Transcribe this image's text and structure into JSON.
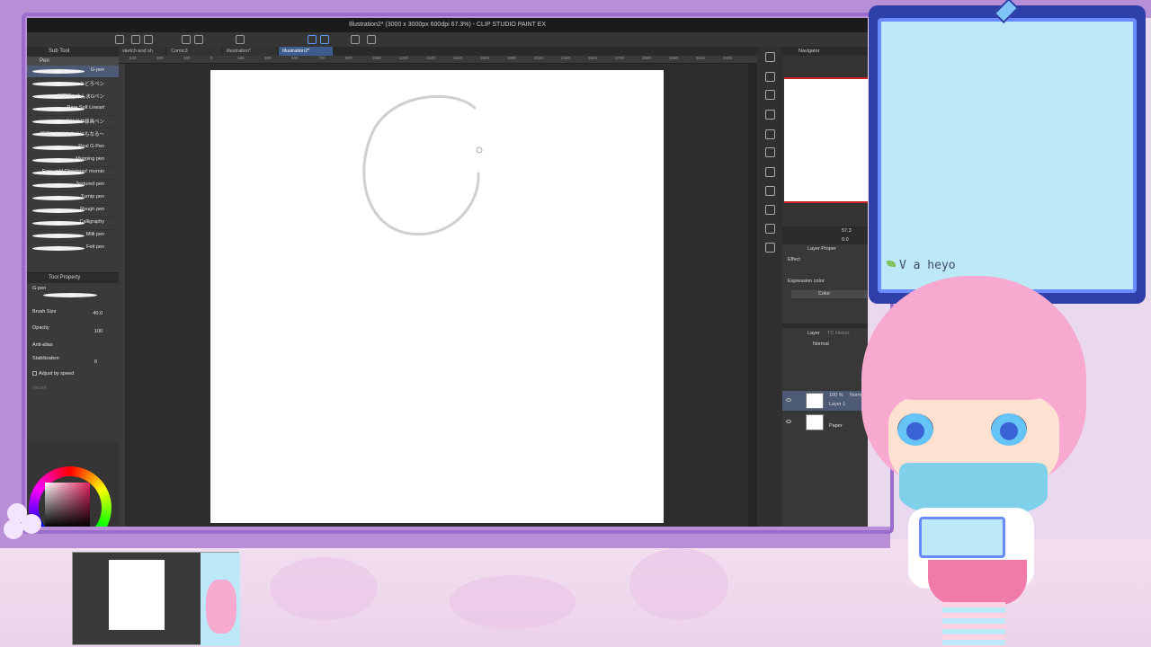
{
  "window": {
    "title": "Illustration2* (3000 x 3000px 600dpi 67.3%) - CLIP STUDIO PAINT EX"
  },
  "tabs": [
    {
      "label": "sketch and sh"
    },
    {
      "label": "Comic3"
    },
    {
      "label": "illustration*"
    },
    {
      "label": "Illustration2*"
    }
  ],
  "ruler_ticks": [
    "540",
    "360",
    "180",
    "0",
    "180",
    "360",
    "540",
    "720",
    "900",
    "1080",
    "1260",
    "1440",
    "1620",
    "1800",
    "1980",
    "2160",
    "2340",
    "2520",
    "2700",
    "2880",
    "3060",
    "3240",
    "3420"
  ],
  "subtool": {
    "header": "Sub Tool",
    "tab": "Pen",
    "brushes": [
      {
        "name": "G-pen"
      },
      {
        "name": "とどろペン"
      },
      {
        "name": "[ 初期版 ] めんまGペン"
      },
      {
        "name": "Rare Soft Lineart"
      },
      {
        "name": "ガサガサ線画ペン"
      },
      {
        "name": "線画にもカキモジにもなる～"
      },
      {
        "name": "Real G-Pen"
      },
      {
        "name": "Mapping pen"
      },
      {
        "name": "Free until Christmas! mornin"
      },
      {
        "name": "Textured pen"
      },
      {
        "name": "Turnip pen"
      },
      {
        "name": "Rough pen"
      },
      {
        "name": "Calligraphy"
      },
      {
        "name": "Milli pen"
      },
      {
        "name": "Felt pen"
      }
    ]
  },
  "tool_property": {
    "header": "Tool Property",
    "preset": "G-pen",
    "brush_size_label": "Brush Size",
    "brush_size_value": "40.0",
    "opacity_label": "Opacity",
    "opacity_value": "100",
    "anti_alias_label": "Anti-alias",
    "stabilization_label": "Stabilization",
    "stabilization_value": "6",
    "adjust_label": "Adjust by speed",
    "vector_label": "Vector"
  },
  "navigator": {
    "header": "Navigator",
    "zoom": "57.3",
    "rotation": "0.0"
  },
  "layer_property": {
    "header": "Layer Proper",
    "effect_label": "Effect",
    "expression_label": "Expression color",
    "color_button": "Color"
  },
  "layer_panel": {
    "header": "Layer",
    "header2": "TC Histori",
    "blend_mode": "Normal",
    "layers": [
      {
        "opacity": "100 %",
        "mode": "Norm",
        "name": "Layer 1"
      },
      {
        "opacity": "",
        "mode": "",
        "name": "Paper"
      }
    ]
  },
  "chat": {
    "text": "V  a  heyo",
    "colors": {
      "frame": "#2e3fa8",
      "panel": "#bde8f7"
    }
  },
  "colors": {
    "accent": "#3e5b8e",
    "overlay_frame": "#b88ed6",
    "current_color": "#e0245e"
  }
}
